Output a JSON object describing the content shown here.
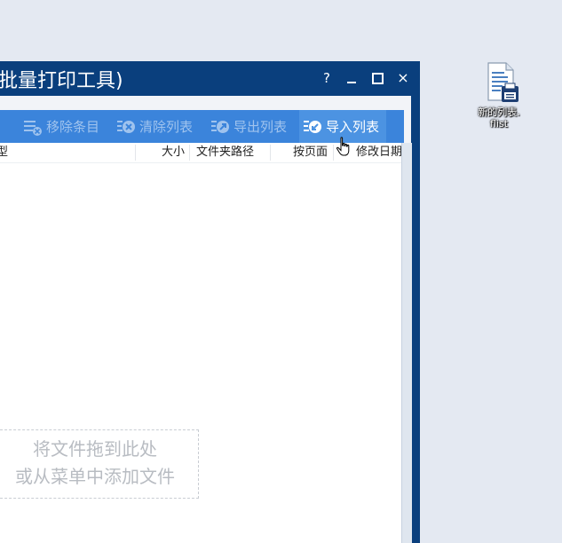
{
  "window": {
    "title": "批量打印工具)",
    "help": "?",
    "close": "×"
  },
  "toolbar": {
    "remove": "移除条目",
    "clear": "清除列表",
    "export": "导出列表",
    "import": "导入列表"
  },
  "table": {
    "columns": [
      "型",
      "大小",
      "文件夹路径",
      "按页面",
      "修改日期"
    ]
  },
  "dropzone": {
    "line1": "将文件拖到此处",
    "line2": "或从菜单中添加文件"
  },
  "desktop": {
    "file_label_1": "新的列表.",
    "file_label_2": "flist"
  },
  "colors": {
    "titlebar": "#0a3f7d",
    "toolbar": "#3b84db",
    "desktop": "#e4e9f2"
  }
}
